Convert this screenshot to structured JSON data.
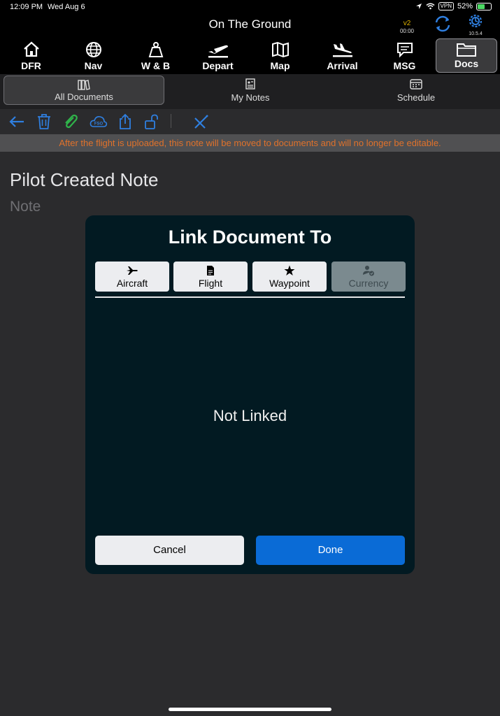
{
  "status_bar": {
    "time": "12:09 PM",
    "date": "Wed Aug 6",
    "vpn": "VPN",
    "battery": "52%",
    "icons": [
      "location-arrow-icon",
      "wifi-icon",
      "battery-charging-icon"
    ]
  },
  "header": {
    "title": "On The Ground",
    "badge_version": "v2",
    "badge_timer": "00:00",
    "app_version": "10.5.4"
  },
  "nav": {
    "items": [
      {
        "label": "DFR",
        "icon": "home-icon"
      },
      {
        "label": "Nav",
        "icon": "globe-icon"
      },
      {
        "label": "W & B",
        "icon": "weight-icon"
      },
      {
        "label": "Depart",
        "icon": "plane-takeoff-icon"
      },
      {
        "label": "Map",
        "icon": "map-icon"
      },
      {
        "label": "Arrival",
        "icon": "plane-landing-icon"
      },
      {
        "label": "MSG",
        "icon": "message-icon"
      },
      {
        "label": "Docs",
        "icon": "folder-icon"
      }
    ],
    "active": "Docs"
  },
  "segments": {
    "all_documents": "All Documents",
    "my_notes": "My Notes",
    "schedule": "Schedule",
    "active": "All Documents"
  },
  "toolbar": {
    "icons": [
      "back-arrow-icon",
      "trash-icon",
      "paperclip-icon",
      "fso-cloud-icon",
      "share-icon",
      "unlock-icon",
      "disconnect-icon"
    ],
    "fso_text": "FSO"
  },
  "warning": "After the flight is uploaded, this note will be moved to documents and will no longer be editable.",
  "note": {
    "title": "Pilot Created Note",
    "body": "Note"
  },
  "modal": {
    "title": "Link Document To",
    "options": [
      {
        "label": "Aircraft",
        "icon": "airplane-icon"
      },
      {
        "label": "Flight",
        "icon": "document-icon"
      },
      {
        "label": "Waypoint",
        "icon": "star-icon"
      },
      {
        "label": "Currency",
        "icon": "person-check-icon",
        "disabled": true
      }
    ],
    "status": "Not Linked",
    "cancel": "Cancel",
    "done": "Done"
  },
  "colors": {
    "accent_blue": "#0a6bd6",
    "warning_orange": "#e0722b",
    "modal_bg": "#021a22",
    "toolbar_icon_blue": "#2f7fe0",
    "paperclip_green": "#2fb34a"
  }
}
